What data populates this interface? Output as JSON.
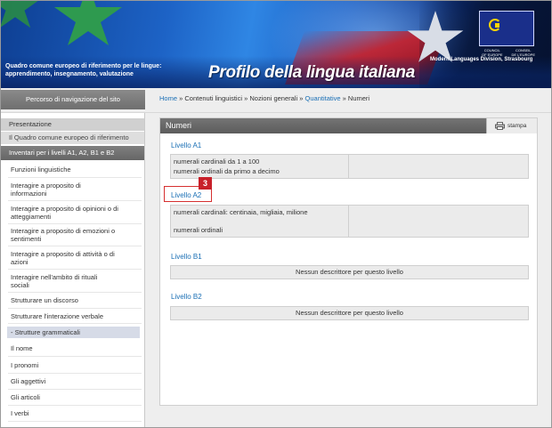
{
  "header": {
    "framework_title_line1": "Quadro comune europeo di riferimento per le lingue:",
    "framework_title_line2": "apprendimento, insegnamento, valutazione",
    "profile_title": "Profilo della lingua italiana",
    "coe_left_line1": "COUNCIL",
    "coe_left_line2": "OF EUROPE",
    "coe_right_line1": "CONSEIL",
    "coe_right_line2": "DE L'EUROPE",
    "division": "Modern Languages Division, Strasbourg"
  },
  "nav": {
    "heading": "Percorso di navigazione del sito",
    "breadcrumb": {
      "home": "Home",
      "sep": "»",
      "contenuti": "Contenuti linguistici",
      "nozioni": "Nozioni generali",
      "quantitative": "Quantitative",
      "current": "Numeri"
    }
  },
  "sidebar": {
    "presentazione": "Presentazione",
    "quadro": "Il Quadro comune europeo di riferimento",
    "inventari": "Inventari per i livelli A1, A2, B1 e B2",
    "items": [
      "Funzioni linguistiche",
      "Interagire a proposito di",
      "informazioni",
      "Interagire a proposito di opinioni o di",
      "atteggiamenti",
      "Interagire a proposito di emozioni o",
      "sentimenti",
      "Interagire a proposito di attività o di",
      "azioni",
      "Interagire nell'ambito di rituali",
      "sociali",
      "Strutturare un discorso",
      "Strutturare l'interazione verbale",
      "- Strutture grammaticali",
      "Il nome",
      "I pronomi",
      "Gli aggettivi",
      "Gli articoli",
      "I verbi"
    ]
  },
  "main": {
    "title": "Numeri",
    "print_label": "stampa",
    "badge": "3",
    "levels": [
      {
        "label": "Livello A1",
        "lines": [
          "numerali cardinali da 1 a 100",
          "numerali ordinali da primo a decimo"
        ]
      },
      {
        "label": "Livello A2",
        "lines": [
          "numerali cardinali: centinaia, migliaia, milione",
          "numerali ordinali"
        ]
      },
      {
        "label": "Livello B1",
        "empty": "Nessun descrittore per questo livello"
      },
      {
        "label": "Livello B2",
        "empty": "Nessun descrittore per questo livello"
      }
    ]
  },
  "colors": {
    "link": "#1a6fb5",
    "header_grey": "#5c5c5c",
    "badge_red": "#c8202a",
    "banner_blue": "#1d63c6"
  }
}
